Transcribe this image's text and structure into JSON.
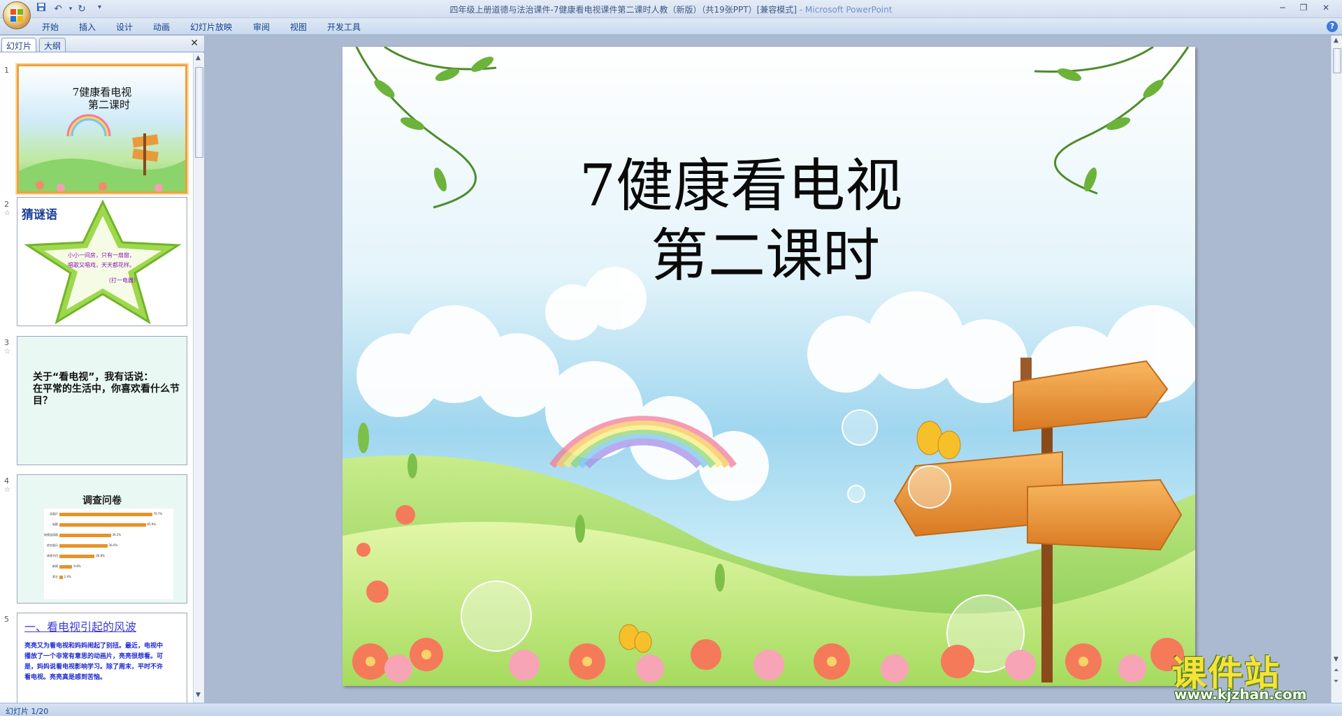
{
  "window": {
    "title": "四年级上册道德与法治课件-7健康看电视课件第二课时人教（新版）（共19张PPT）[兼容模式]",
    "app_name": "- Microsoft PowerPoint"
  },
  "ribbon": {
    "tabs": [
      "开始",
      "插入",
      "设计",
      "动画",
      "幻灯片放映",
      "审阅",
      "视图",
      "开发工具"
    ]
  },
  "pane": {
    "tab_slides": "幻灯片",
    "tab_outline": "大纲",
    "close_glyph": "✕"
  },
  "thumbnails": [
    {
      "num": "1",
      "title_line1": "7健康看电视",
      "title_line2": "第二课时"
    },
    {
      "num": "2",
      "title": "猜谜语",
      "text_line1": "小小一间房，只有一扇窗，",
      "text_line2": "唱歌又唱戏，天天都花样。",
      "text_line3": "（打一电器）"
    },
    {
      "num": "3",
      "text_line1": "关于“看电视”，我有话说：",
      "text_line2": "在平常的生活中，你喜欢看什么节目？"
    },
    {
      "num": "4",
      "title": "调查问卷",
      "bars": [
        {
          "label": "动画片",
          "value": 70.7
        },
        {
          "label": "电影",
          "value": 65.9
        },
        {
          "label": "电视连续剧",
          "value": 39.2
        },
        {
          "label": "综艺娱乐",
          "value": 36.6
        },
        {
          "label": "体育节目",
          "value": 26.8
        },
        {
          "label": "新闻",
          "value": 9.8
        },
        {
          "label": "其它",
          "value": 2.4
        }
      ]
    },
    {
      "num": "5",
      "title": "一、看电视引起的风波",
      "text": "亮亮又为看电视和妈妈闹起了别扭。最近，电视中播放了一个非常有意思的动画片，亮亮很想看。可是，妈妈说看电视影响学习。除了周末，平时不许看电视。亮亮真是感到苦恼。"
    }
  ],
  "slide": {
    "title_line1": "7健康看电视",
    "title_line2": "第二课时"
  },
  "watermark": {
    "brand": "课件站",
    "url": "www.kjzhan.com"
  },
  "status": {
    "text": "幻灯片 1/20"
  },
  "colors": {
    "selected_border": "#f0a23a",
    "ribbon_text": "#15428b",
    "bar": "#e8922a"
  }
}
